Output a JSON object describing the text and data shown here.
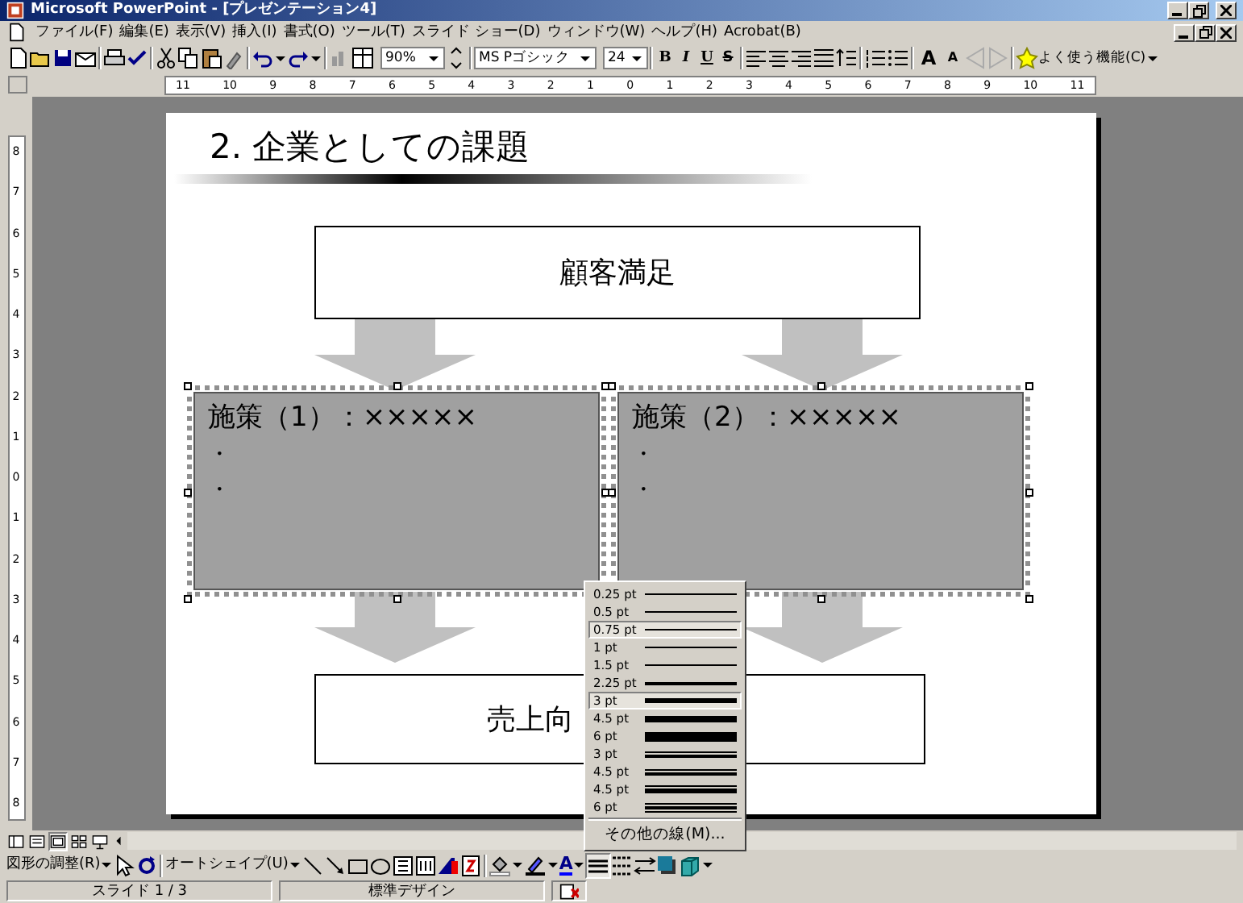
{
  "window": {
    "title": "Microsoft PowerPoint - [プレゼンテーション4]"
  },
  "menu": [
    "ファイル(F)",
    "編集(E)",
    "表示(V)",
    "挿入(I)",
    "書式(O)",
    "ツール(T)",
    "スライド ショー(D)",
    "ウィンドウ(W)",
    "ヘルプ(H)",
    "Acrobat(B)"
  ],
  "toolbar": {
    "zoom": "90%",
    "font": "MS Pゴシック",
    "size": "24",
    "format_buttons": [
      "B",
      "I",
      "U",
      "S"
    ],
    "grow_font": "A",
    "shrink_font": "A",
    "outline_arrows": {
      "disabled": true
    },
    "favorites": "よく使う機能(C)"
  },
  "ruler_horizontal": [
    "11",
    "10",
    "9",
    "8",
    "7",
    "6",
    "5",
    "4",
    "3",
    "2",
    "1",
    "0",
    "1",
    "2",
    "3",
    "4",
    "5",
    "6",
    "7",
    "8",
    "9",
    "10",
    "11"
  ],
  "ruler_vertical": [
    "8",
    "7",
    "6",
    "5",
    "4",
    "3",
    "2",
    "1",
    "0",
    "1",
    "2",
    "3",
    "4",
    "5",
    "6",
    "7",
    "8"
  ],
  "slide": {
    "title": "2. 企業としての課題",
    "top_box": "顧客満足",
    "measures": [
      {
        "heading": "施策（1）：×××××",
        "bullets": [
          "・",
          "・"
        ],
        "selected": true
      },
      {
        "heading": "施策（2）：×××××",
        "bullets": [
          "・",
          "・"
        ],
        "selected": true
      }
    ],
    "bottom_box": "売上向"
  },
  "view_buttons": [
    {
      "selected": false
    },
    {
      "selected": false
    },
    {
      "selected": true
    },
    {
      "selected": false
    },
    {
      "selected": false
    }
  ],
  "drawing_toolbar": {
    "arrange": "図形の調整(R)",
    "autoshapes": "オートシェイプ(U)",
    "font_color": "A",
    "line_style_open": true
  },
  "line_menu": {
    "items": [
      {
        "label": "0.25 pt",
        "kind": "hair",
        "selected": false
      },
      {
        "label": "0.5 pt",
        "kind": "thin",
        "selected": false
      },
      {
        "label": "0.75 pt",
        "kind": "thin",
        "selected": true
      },
      {
        "label": "1 pt",
        "kind": "regular",
        "selected": false
      },
      {
        "label": "1.5 pt",
        "kind": "regular",
        "selected": false
      },
      {
        "label": "2.25 pt",
        "kind": "medium",
        "selected": false
      },
      {
        "label": "3 pt",
        "kind": "bold",
        "selected": true
      },
      {
        "label": "4.5 pt",
        "kind": "heavy",
        "selected": false
      },
      {
        "label": "6 pt",
        "kind": "black",
        "selected": false
      },
      {
        "label": "3 pt",
        "kind": "double",
        "selected": false
      },
      {
        "label": "4.5 pt",
        "kind": "double",
        "selected": false
      },
      {
        "label": "4.5 pt",
        "kind": "thinthick",
        "selected": false
      },
      {
        "label": "6 pt",
        "kind": "triple",
        "selected": false
      }
    ],
    "more": "その他の線(M)..."
  },
  "status_bar": {
    "slide": "スライド 1 / 3",
    "design": "標準デザイン"
  }
}
